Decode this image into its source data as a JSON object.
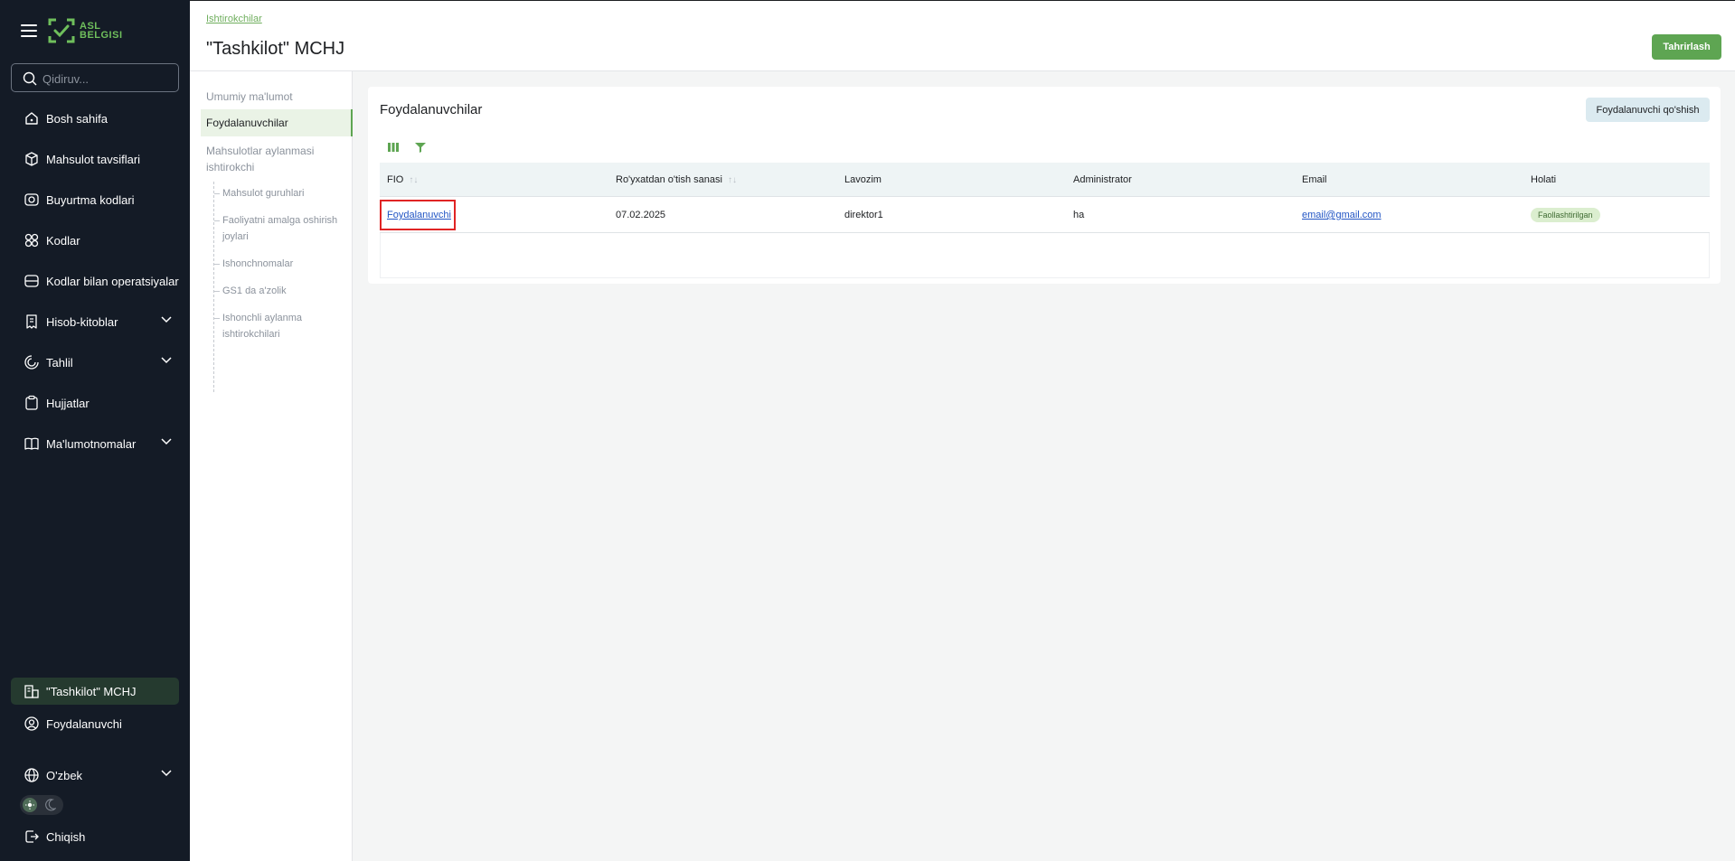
{
  "sidebar": {
    "logo_text_line1": "ASL",
    "logo_text_line2": "BELGISI",
    "search_placeholder": "Qidiruv...",
    "items": [
      {
        "label": "Bosh sahifa",
        "icon": "home-icon"
      },
      {
        "label": "Mahsulot tavsiflari",
        "icon": "cube-icon"
      },
      {
        "label": "Buyurtma kodlari",
        "icon": "code-order-icon"
      },
      {
        "label": "Kodlar",
        "icon": "codes-icon"
      },
      {
        "label": "Kodlar bilan operatsiyalar",
        "icon": "operations-icon"
      },
      {
        "label": "Hisob-kitoblar",
        "icon": "receipt-icon",
        "expandable": true
      },
      {
        "label": "Tahlil",
        "icon": "analytics-icon",
        "expandable": true
      },
      {
        "label": "Hujjatlar",
        "icon": "clipboard-icon"
      },
      {
        "label": "Ma'lumotnomalar",
        "icon": "book-icon",
        "expandable": true
      }
    ],
    "bottom": {
      "org": "\"Tashkilot\" MCHJ",
      "user": "Foydalanuvchi",
      "language": "O'zbek",
      "logout": "Chiqish"
    }
  },
  "header": {
    "breadcrumb": "Ishtirokchilar",
    "title": "\"Tashkilot\" MCHJ",
    "edit_button": "Tahrirlash"
  },
  "subnav": {
    "items": [
      "Umumiy ma'lumot",
      "Foydalanuvchilar",
      "Mahsulotlar aylanmasi",
      "ishtirokchi"
    ],
    "sub_items": [
      "Mahsulot guruhlari",
      "Faoliyatni amalga oshirish",
      "joylari",
      "Ishonchnomalar",
      "GS1 da a'zolik",
      "Ishonchli aylanma",
      "ishtirokchilari"
    ]
  },
  "users": {
    "title": "Foydalanuvchilar",
    "add_button": "Foydalanuvchi qo'shish",
    "columns": [
      "FIO",
      "Ro'yxatdan o'tish sanasi",
      "Lavozim",
      "Administrator",
      "Email",
      "Holati"
    ],
    "rows": [
      {
        "fio": "Foydalanuvchi",
        "date": "07.02.2025",
        "position": "direktor1",
        "admin": "ha",
        "email": "email@gmail.com",
        "status": "Faollashtirilgan"
      }
    ]
  },
  "colors": {
    "sidebar_bg": "#141b26",
    "accent": "#5ea552",
    "link": "#2255c4",
    "highlight": "#e02424"
  }
}
